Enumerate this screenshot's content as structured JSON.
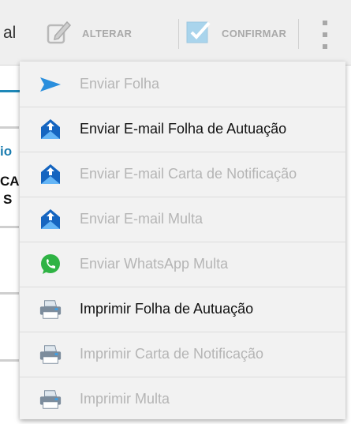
{
  "toolbar": {
    "left_fragment": "al",
    "alterar_label": "ALTERAR",
    "confirmar_label": "CONFIRMAR",
    "overflow_icon": "overflow-menu-icon"
  },
  "background": {
    "frag1": "io",
    "frag2": "CA",
    "frag3": "S"
  },
  "menu": {
    "items": [
      {
        "label": "Enviar Folha",
        "icon": "send-icon",
        "enabled": false
      },
      {
        "label": "Enviar E-mail Folha de Autuação",
        "icon": "email-icon",
        "enabled": true
      },
      {
        "label": "Enviar E-mail Carta de Notificação",
        "icon": "email-icon",
        "enabled": false
      },
      {
        "label": "Enviar E-mail Multa",
        "icon": "email-icon",
        "enabled": false
      },
      {
        "label": "Enviar WhatsApp Multa",
        "icon": "whatsapp-icon",
        "enabled": false
      },
      {
        "label": "Imprimir Folha de Autuação",
        "icon": "printer-icon",
        "enabled": true
      },
      {
        "label": "Imprimir Carta de Notificação",
        "icon": "printer-icon",
        "enabled": false
      },
      {
        "label": "Imprimir Multa",
        "icon": "printer-icon",
        "enabled": false
      }
    ]
  },
  "colors": {
    "accent": "#1e88b8",
    "whatsapp": "#2fb344",
    "disabled_text": "#b5b5b5"
  }
}
